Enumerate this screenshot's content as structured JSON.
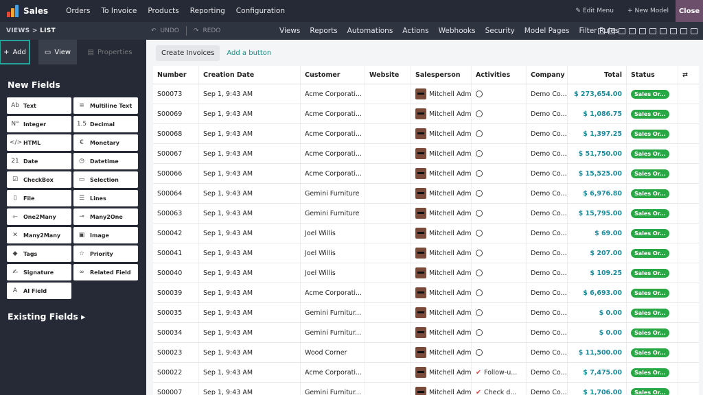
{
  "app": {
    "title": "Sales",
    "logo_colors": [
      "#e8453c",
      "#f3a33b",
      "#4b9de0"
    ],
    "menu": [
      "Orders",
      "To Invoice",
      "Products",
      "Reporting",
      "Configuration"
    ],
    "edit_menu": "Edit Menu",
    "new_model": "New Model",
    "close": "Close"
  },
  "studio": {
    "breadcrumb_views": "VIEWS",
    "breadcrumb_sep": ">",
    "breadcrumb_current": "LIST",
    "undo": "UNDO",
    "redo": "REDO",
    "menu": [
      "Views",
      "Reports",
      "Automations",
      "Actions",
      "Webhooks",
      "Security",
      "Model Pages",
      "Filter Rules"
    ]
  },
  "sidebar": {
    "tabs": {
      "add": "Add",
      "view": "View",
      "properties": "Properties"
    },
    "new_fields_title": "New Fields",
    "fields": [
      {
        "label": "Text",
        "icon": "Ab"
      },
      {
        "label": "Multiline Text",
        "icon": "≡"
      },
      {
        "label": "Integer",
        "icon": "N°"
      },
      {
        "label": "Decimal",
        "icon": "1.5"
      },
      {
        "label": "HTML",
        "icon": "</>"
      },
      {
        "label": "Monetary",
        "icon": "€"
      },
      {
        "label": "Date",
        "icon": "21"
      },
      {
        "label": "Datetime",
        "icon": "◷"
      },
      {
        "label": "CheckBox",
        "icon": "☑"
      },
      {
        "label": "Selection",
        "icon": "▭"
      },
      {
        "label": "File",
        "icon": "▯"
      },
      {
        "label": "Lines",
        "icon": "☰"
      },
      {
        "label": "One2Many",
        "icon": "⟜"
      },
      {
        "label": "Many2One",
        "icon": "⊸"
      },
      {
        "label": "Many2Many",
        "icon": "✕"
      },
      {
        "label": "Image",
        "icon": "▣"
      },
      {
        "label": "Tags",
        "icon": "◆"
      },
      {
        "label": "Priority",
        "icon": "☆"
      },
      {
        "label": "Signature",
        "icon": "✍"
      },
      {
        "label": "Related Field",
        "icon": "∞"
      },
      {
        "label": "AI Field",
        "icon": "A"
      }
    ],
    "existing_fields_title": "Existing Fields"
  },
  "main": {
    "create_invoices": "Create Invoices",
    "add_button": "Add a button",
    "columns": [
      "Number",
      "Creation Date",
      "Customer",
      "Website",
      "Salesperson",
      "Activities",
      "Company",
      "Total",
      "Status"
    ],
    "rows": [
      {
        "number": "S00073",
        "date": "Sep 1, 9:43 AM",
        "customer": "Acme Corporati...",
        "website": "",
        "salesperson": "Mitchell Adm",
        "activity": "",
        "company": "Demo Co...",
        "total": "$ 273,654.00",
        "status": "Sales Or..."
      },
      {
        "number": "S00069",
        "date": "Sep 1, 9:43 AM",
        "customer": "Acme Corporati...",
        "website": "",
        "salesperson": "Mitchell Adm",
        "activity": "",
        "company": "Demo Co...",
        "total": "$ 1,086.75",
        "status": "Sales Or..."
      },
      {
        "number": "S00068",
        "date": "Sep 1, 9:43 AM",
        "customer": "Acme Corporati...",
        "website": "",
        "salesperson": "Mitchell Adm",
        "activity": "",
        "company": "Demo Co...",
        "total": "$ 1,397.25",
        "status": "Sales Or..."
      },
      {
        "number": "S00067",
        "date": "Sep 1, 9:43 AM",
        "customer": "Acme Corporati...",
        "website": "",
        "salesperson": "Mitchell Adm",
        "activity": "",
        "company": "Demo Co...",
        "total": "$ 51,750.00",
        "status": "Sales Or..."
      },
      {
        "number": "S00066",
        "date": "Sep 1, 9:43 AM",
        "customer": "Acme Corporati...",
        "website": "",
        "salesperson": "Mitchell Adm",
        "activity": "",
        "company": "Demo Co...",
        "total": "$ 15,525.00",
        "status": "Sales Or..."
      },
      {
        "number": "S00064",
        "date": "Sep 1, 9:43 AM",
        "customer": "Gemini Furniture",
        "website": "",
        "salesperson": "Mitchell Adm",
        "activity": "",
        "company": "Demo Co...",
        "total": "$ 6,976.80",
        "status": "Sales Or..."
      },
      {
        "number": "S00063",
        "date": "Sep 1, 9:43 AM",
        "customer": "Gemini Furniture",
        "website": "",
        "salesperson": "Mitchell Adm",
        "activity": "",
        "company": "Demo Co...",
        "total": "$ 15,795.00",
        "status": "Sales Or..."
      },
      {
        "number": "S00042",
        "date": "Sep 1, 9:43 AM",
        "customer": "Joel Willis",
        "website": "",
        "salesperson": "Mitchell Adm",
        "activity": "",
        "company": "Demo Co...",
        "total": "$ 69.00",
        "status": "Sales Or..."
      },
      {
        "number": "S00041",
        "date": "Sep 1, 9:43 AM",
        "customer": "Joel Willis",
        "website": "",
        "salesperson": "Mitchell Adm",
        "activity": "",
        "company": "Demo Co...",
        "total": "$ 207.00",
        "status": "Sales Or..."
      },
      {
        "number": "S00040",
        "date": "Sep 1, 9:43 AM",
        "customer": "Joel Willis",
        "website": "",
        "salesperson": "Mitchell Adm",
        "activity": "",
        "company": "Demo Co...",
        "total": "$ 109.25",
        "status": "Sales Or..."
      },
      {
        "number": "S00039",
        "date": "Sep 1, 9:43 AM",
        "customer": "Acme Corporati...",
        "website": "",
        "salesperson": "Mitchell Adm",
        "activity": "",
        "company": "Demo Co...",
        "total": "$ 6,693.00",
        "status": "Sales Or..."
      },
      {
        "number": "S00035",
        "date": "Sep 1, 9:43 AM",
        "customer": "Gemini Furnitur...",
        "website": "",
        "salesperson": "Mitchell Adm",
        "activity": "",
        "company": "Demo Co...",
        "total": "$ 0.00",
        "status": "Sales Or..."
      },
      {
        "number": "S00034",
        "date": "Sep 1, 9:43 AM",
        "customer": "Gemini Furnitur...",
        "website": "",
        "salesperson": "Mitchell Adm",
        "activity": "",
        "company": "Demo Co...",
        "total": "$ 0.00",
        "status": "Sales Or..."
      },
      {
        "number": "S00023",
        "date": "Sep 1, 9:43 AM",
        "customer": "Wood Corner",
        "website": "",
        "salesperson": "Mitchell Adm",
        "activity": "",
        "company": "Demo Co...",
        "total": "$ 11,500.00",
        "status": "Sales Or..."
      },
      {
        "number": "S00022",
        "date": "Sep 1, 9:43 AM",
        "customer": "Acme Corporati...",
        "website": "",
        "salesperson": "Mitchell Adm",
        "activity": "Follow-u...",
        "company": "Demo Co...",
        "total": "$ 7,475.00",
        "status": "Sales Or..."
      },
      {
        "number": "S00007",
        "date": "Sep 1, 9:43 AM",
        "customer": "Gemini Furnitur...",
        "website": "",
        "salesperson": "Mitchell Adm",
        "activity": "Check d...",
        "company": "Demo Co...",
        "total": "$ 1,706.00",
        "status": "Sales Or..."
      }
    ]
  }
}
